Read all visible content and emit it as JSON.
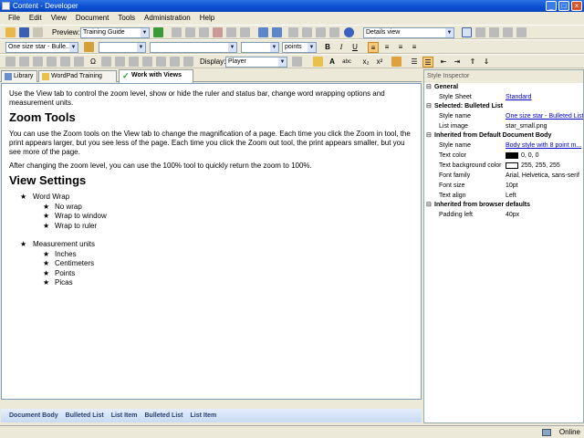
{
  "window": {
    "title": "Content - Developer"
  },
  "menu": [
    "File",
    "Edit",
    "View",
    "Document",
    "Tools",
    "Administration",
    "Help"
  ],
  "toolbar1": {
    "preview_label": "Preview:",
    "preview_value": "Training Guide",
    "view_value": "Details view"
  },
  "toolbar2": {
    "style_value": "One size star - Bulle...",
    "font_value": "",
    "size_value": "",
    "units_value": "points"
  },
  "toolbar3": {
    "display_label": "Display:",
    "display_value": "Player"
  },
  "tabs": [
    {
      "label": "Library"
    },
    {
      "label": "WordPad Training"
    },
    {
      "label": "Work with Views"
    }
  ],
  "doc": {
    "intro": "Use the View tab to control the zoom level, show or hide the ruler and status bar, change word wrapping options and measurement units.",
    "h_zoom": "Zoom Tools",
    "p_zoom1": "You can use the Zoom tools on the View tab to change the magnification of a page. Each time you click the Zoom in tool, the print appears larger, but you see less of the page. Each time you click the Zoom out tool, the print appears smaller, but you see more of the page.",
    "p_zoom2": "After changing the zoom level, you can use the 100% tool to quickly return the zoom to 100%.",
    "h_view": "View Settings",
    "word_wrap": "Word Wrap",
    "wrap_items": [
      "No wrap",
      "Wrap to window",
      "Wrap to ruler"
    ],
    "measure": "Measurement units",
    "measure_items": [
      "Inches",
      "Centimeters",
      "Points",
      "Picas"
    ]
  },
  "breadcrumbs": [
    "Document Body",
    "Bulleted List",
    "List Item",
    "Bulleted List",
    "List Item"
  ],
  "inspector": {
    "title": "Style Inspector",
    "general": "General",
    "stylesheet_k": "Style Sheet",
    "stylesheet_v": "Standard",
    "selected": "Selected: Bulleted List",
    "stylename_k": "Style name",
    "stylename_v": "One size star - Bulleted List",
    "listimage_k": "List image",
    "listimage_v": "star_small.png",
    "inherited_doc": "Inherited from Default Document Body",
    "body_stylename_k": "Style name",
    "body_stylename_v": "Body style with 8 point m...",
    "textcolor_k": "Text color",
    "textcolor_v": "0, 0, 0",
    "textbg_k": "Text background color",
    "textbg_v": "255, 255, 255",
    "fontfamily_k": "Font family",
    "fontfamily_v": "Arial, Helvetica, sans-serif",
    "fontsize_k": "Font size",
    "fontsize_v": "10pt",
    "textalign_k": "Text align",
    "textalign_v": "Left",
    "inherited_browser": "Inherited from browser defaults",
    "padding_k": "Padding left",
    "padding_v": "40px",
    "textcolor_swatch": "#000000",
    "textbg_swatch": "#ffffff"
  },
  "status": {
    "online": "Online"
  }
}
